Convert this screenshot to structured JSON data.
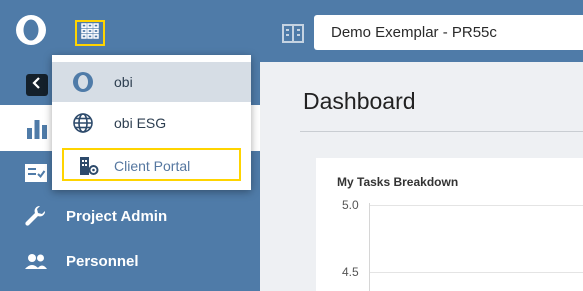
{
  "header": {
    "project_selector_value": "Demo Exemplar - PR55c",
    "logo_icon": "obi-ring-logo",
    "apps_icon": "grid-icon",
    "building_icon": "building-icon"
  },
  "app_menu": {
    "items": [
      {
        "label": "obi",
        "icon": "obi-logo-icon"
      },
      {
        "label": "obi ESG",
        "icon": "globe-icon"
      },
      {
        "label": "Client Portal",
        "icon": "portal-building-icon"
      }
    ]
  },
  "sidebar": {
    "items": [
      {
        "label": "",
        "icon": "bar-chart-icon"
      },
      {
        "label": "",
        "icon": "checklist-icon"
      },
      {
        "label": "Project Admin",
        "icon": "wrench-icon"
      },
      {
        "label": "Personnel",
        "icon": "people-icon"
      }
    ]
  },
  "main": {
    "page_title": "Dashboard",
    "card_title": "My Tasks Breakdown"
  },
  "chart_data": {
    "type": "bar",
    "title": "My Tasks Breakdown",
    "y_ticks": [
      "5.0",
      "4.5"
    ],
    "ylim_visible": [
      4.5,
      5.0
    ],
    "categories": [],
    "values": []
  },
  "colors": {
    "primary": "#4f7ba8",
    "highlight": "#ffd400",
    "dark": "#14202b"
  }
}
